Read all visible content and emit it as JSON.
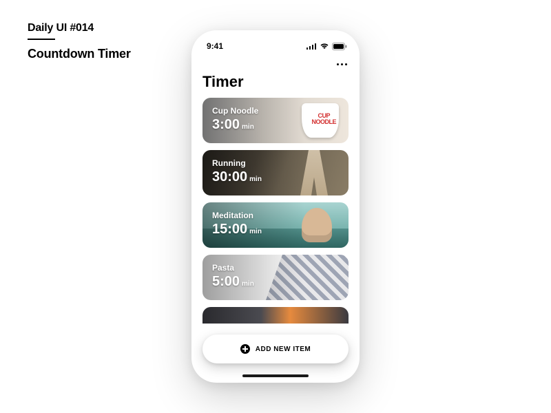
{
  "page": {
    "series_label": "Daily UI #014",
    "title": "Countdown Timer"
  },
  "status": {
    "time": "9:41"
  },
  "screen": {
    "title": "Timer"
  },
  "timers": [
    {
      "label": "Cup Noodle",
      "value": "3:00",
      "unit": "min"
    },
    {
      "label": "Running",
      "value": "30:00",
      "unit": "min"
    },
    {
      "label": "Meditation",
      "value": "15:00",
      "unit": "min"
    },
    {
      "label": "Pasta",
      "value": "5:00",
      "unit": "min"
    }
  ],
  "decor": {
    "cup_label_line1": "CUP",
    "cup_label_line2": "NOODLE"
  },
  "add_button": {
    "label": "ADD NEW ITEM"
  }
}
